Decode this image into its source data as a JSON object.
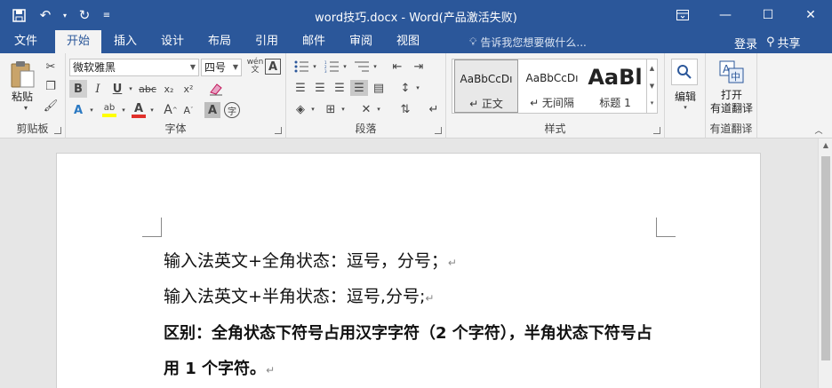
{
  "titlebar": {
    "title": "word技巧.docx - Word(产品激活失败)",
    "qat": {
      "save_icon": "save-icon",
      "undo_icon": "undo-icon",
      "redo_icon": "redo-icon",
      "customize_icon": "customize-qat-icon"
    },
    "ribbon_display_icon": "ribbon-display-options-icon",
    "minimize": "—",
    "maximize": "☐",
    "close": "✕"
  },
  "tabs": [
    {
      "label": "文件"
    },
    {
      "label": "开始"
    },
    {
      "label": "插入"
    },
    {
      "label": "设计"
    },
    {
      "label": "布局"
    },
    {
      "label": "引用"
    },
    {
      "label": "邮件"
    },
    {
      "label": "审阅"
    },
    {
      "label": "视图"
    }
  ],
  "tellme": "告诉我您想要做什么...",
  "account": {
    "login": "登录",
    "share": "共享"
  },
  "ribbon": {
    "clipboard": {
      "paste": "粘贴",
      "label": "剪贴板"
    },
    "font": {
      "font_name": "微软雅黑",
      "font_size": "四号",
      "wen": "wén",
      "wen_char": "文",
      "bold": "B",
      "italic": "I",
      "underline": "U",
      "strike": "abc",
      "subscript": "x₂",
      "superscript": "x²",
      "font_color_letter": "A",
      "highlight_letter": "ab",
      "grow": "A",
      "shrink": "A",
      "char_shading": "A",
      "enclose": "字",
      "label": "字体"
    },
    "paragraph": {
      "label": "段落"
    },
    "styles": {
      "items": [
        {
          "preview": "AaBbCcDı",
          "name": "↵ 正文"
        },
        {
          "preview": "AaBbCcDı",
          "name": "↵ 无间隔"
        },
        {
          "preview": "AaBl",
          "name": "标题 1"
        }
      ],
      "label": "样式"
    },
    "editing": {
      "label": "编辑"
    },
    "youdao": {
      "open": "打开",
      "name": "有道翻译",
      "label": "有道翻译"
    }
  },
  "document": {
    "lines": [
      "输入法英文+全角状态：逗号，分号；",
      "输入法英文+半角状态：逗号,分号;",
      "区别：全角状态下符号占用汉字字符（2 个字符），半角状态下符号占",
      "用 1 个字符。"
    ],
    "paragraph_mark": "↵"
  }
}
